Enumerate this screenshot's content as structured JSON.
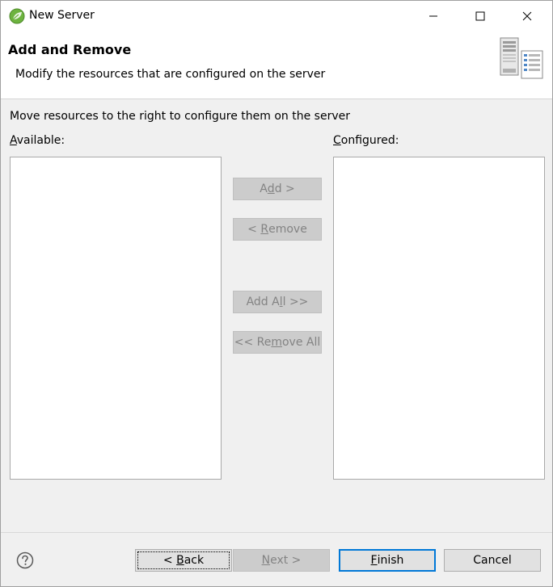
{
  "window": {
    "title": "New Server"
  },
  "banner": {
    "title": "Add and Remove",
    "description": "Modify the resources that are configured on the server"
  },
  "instruction": "Move resources to the right to configure them on the server",
  "available": {
    "label_mnemonic": "A",
    "label_rest": "vailable:",
    "items": []
  },
  "configured": {
    "label_mnemonic": "C",
    "label_rest": "onfigured:",
    "items": []
  },
  "buttons": {
    "add": {
      "pre": "A",
      "mn": "d",
      "post": "d >"
    },
    "remove": {
      "pre": "< ",
      "mn": "R",
      "post": "emove"
    },
    "add_all": {
      "pre": "Add A",
      "mn": "l",
      "post": "l >>"
    },
    "remove_all": {
      "pre": "<< Re",
      "mn": "m",
      "post": "ove All"
    }
  },
  "footer": {
    "back": {
      "pre": "< ",
      "mn": "B",
      "post": "ack"
    },
    "next": {
      "pre": "",
      "mn": "N",
      "post": "ext >"
    },
    "finish": {
      "pre": "",
      "mn": "F",
      "post": "inish"
    },
    "cancel": "Cancel"
  },
  "colors": {
    "disabled_button_bg": "#cccccc",
    "disabled_text": "#838383",
    "default_button_border": "#0078d7"
  }
}
